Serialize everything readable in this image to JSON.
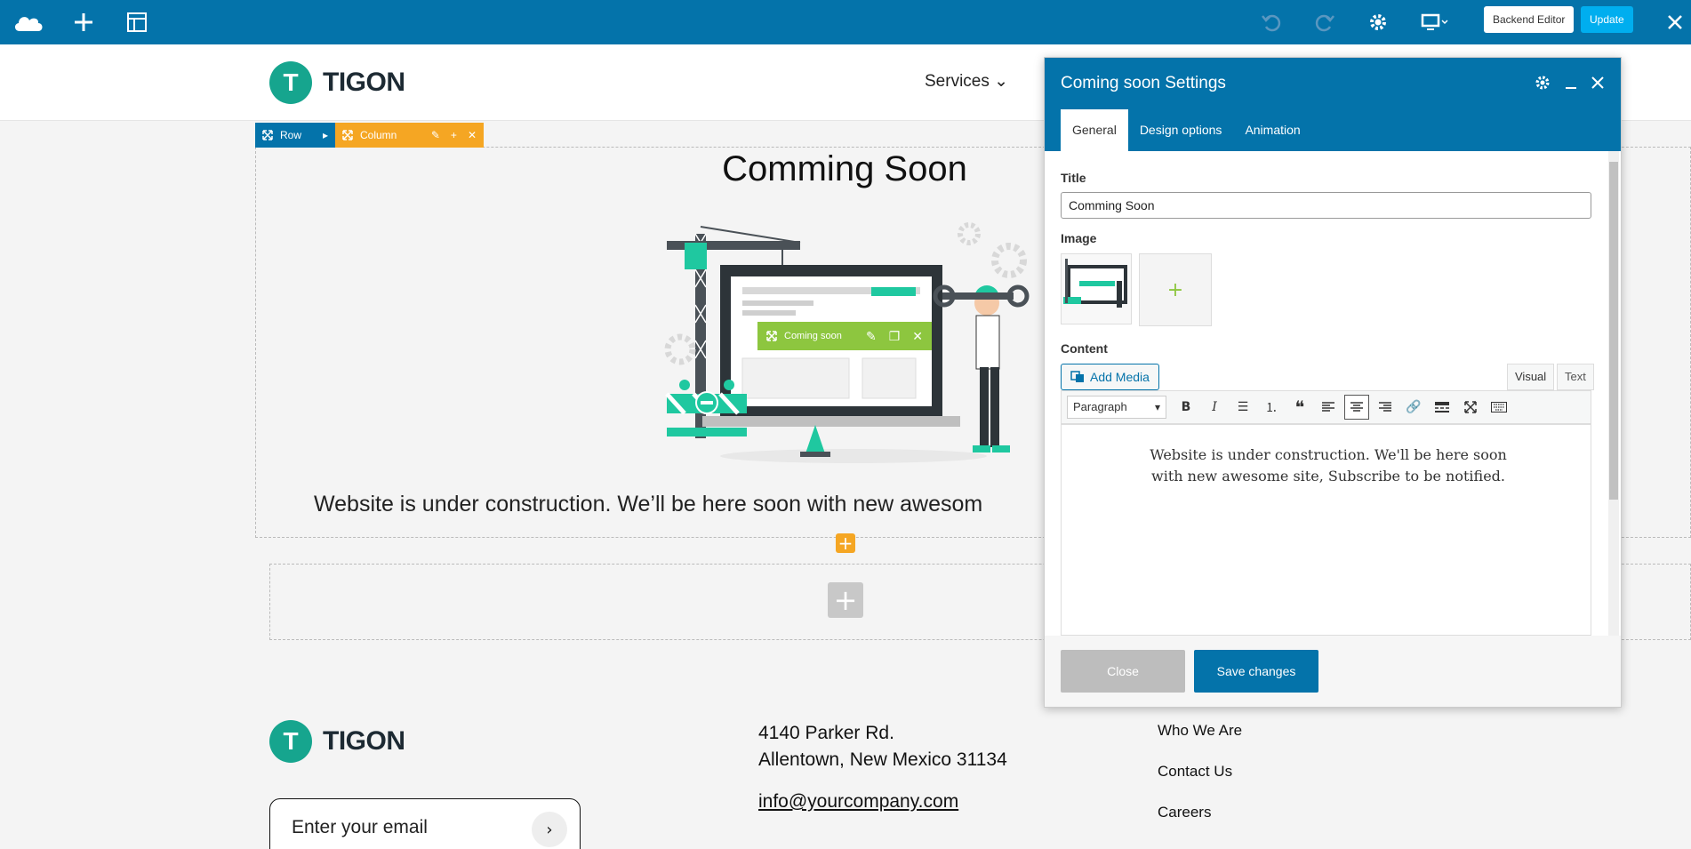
{
  "toolbar": {
    "backend_editor_label": "Backend Editor",
    "update_label": "Update",
    "accent": "#0473aa"
  },
  "site": {
    "logo_letter": "T",
    "logo_text": "TIGON",
    "nav": {
      "services": "Services ⌄"
    }
  },
  "builder": {
    "row_label": "Row",
    "column_label": "Column",
    "element_label": "Coming soon"
  },
  "page": {
    "title": "Comming Soon",
    "text": "Website is under construction. We’ll be here soon with new awesom"
  },
  "footer": {
    "logo_letter": "T",
    "logo_text": "TIGON",
    "address_line1": "4140 Parker Rd.",
    "address_line2": "Allentown, New Mexico 31134",
    "email": "info@yourcompany.com",
    "email_placeholder": "Enter your email",
    "links": [
      "Who We Are",
      "Contact Us",
      "Careers"
    ]
  },
  "panel": {
    "title": "Coming soon Settings",
    "tabs": [
      "General",
      "Design options",
      "Animation"
    ],
    "title_label": "Title",
    "title_value": "Comming Soon",
    "image_label": "Image",
    "content_label": "Content",
    "add_media_label": "Add Media",
    "visual_tab": "Visual",
    "text_tab": "Text",
    "format_select": "Paragraph",
    "content_text": "Website is under construction. We'll be here soon with new awesome site, Subscribe to be notified.",
    "close_label": "Close",
    "save_label": "Save changes"
  }
}
